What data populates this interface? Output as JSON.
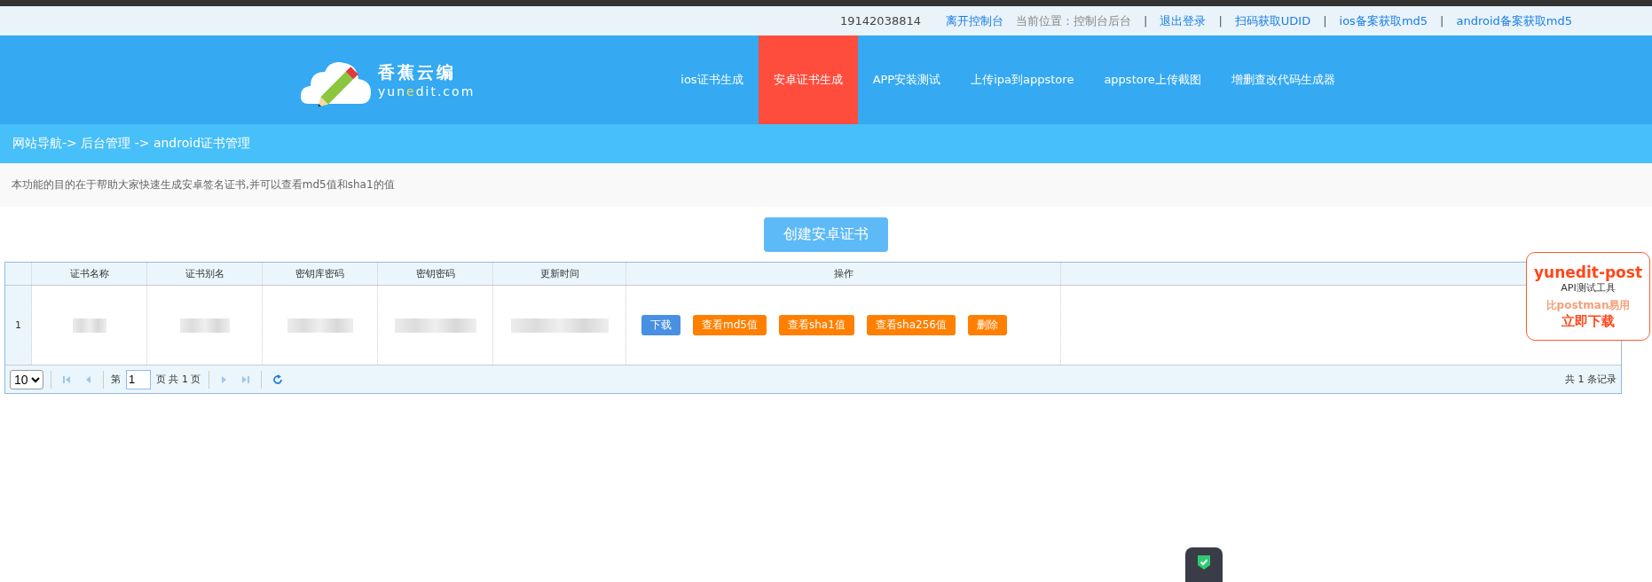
{
  "top_bar": {
    "phone": "19142038814",
    "items": [
      {
        "kind": "link",
        "text": "离开控制台"
      },
      {
        "kind": "text",
        "text": "当前位置：控制台后台"
      },
      {
        "kind": "sep",
        "text": "|"
      },
      {
        "kind": "link",
        "text": "退出登录"
      },
      {
        "kind": "sep",
        "text": "|"
      },
      {
        "kind": "link",
        "text": "扫码获取UDID"
      },
      {
        "kind": "sep",
        "text": "|"
      },
      {
        "kind": "link",
        "text": "ios备案获取md5"
      },
      {
        "kind": "sep",
        "text": "|"
      },
      {
        "kind": "link",
        "text": "android备案获取md5"
      }
    ]
  },
  "logo": {
    "name": "香蕉云编",
    "domain": [
      {
        "text": "yun",
        "accent": false
      },
      {
        "text": "e",
        "accent": true
      },
      {
        "text": "dit.com",
        "accent": false
      }
    ]
  },
  "nav": [
    {
      "label": "ios证书生成",
      "selected": false
    },
    {
      "label": "安卓证书生成",
      "selected": true
    },
    {
      "label": "APP安装测试",
      "selected": false
    },
    {
      "label": "上传ipa到appstore",
      "selected": false
    },
    {
      "label": "appstore上传截图",
      "selected": false
    },
    {
      "label": "增删查改代码生成器",
      "selected": false
    }
  ],
  "breadcrumb": "网站导航-> 后台管理 -> android证书管理",
  "description": "本功能的目的在于帮助大家快速生成安卓签名证书,并可以查看md5值和sha1的值",
  "create_button": "创建安卓证书",
  "table": {
    "columns": [
      "证书名称",
      "证书别名",
      "密钥库密码",
      "密钥密码",
      "更新时间",
      "操作"
    ],
    "rows": [
      {
        "number": "1",
        "cells": [
          {
            "redacted": true
          },
          {
            "redacted": true
          },
          {
            "redacted": true
          },
          {
            "redacted": true
          },
          {
            "redacted": true
          }
        ],
        "actions": [
          {
            "label": "下载",
            "kind": "primary"
          },
          {
            "label": "查看md5值",
            "kind": "warning"
          },
          {
            "label": "查看sha1值",
            "kind": "warning"
          },
          {
            "label": "查看sha256值",
            "kind": "warning"
          },
          {
            "label": "删除",
            "kind": "warning"
          }
        ]
      }
    ],
    "pager": {
      "page_size": "10",
      "page_prefix": "第",
      "page": "1",
      "page_suffix": "页 共 1 页",
      "total": "共 1 条记录"
    }
  },
  "ad": {
    "title": "yunedit-post",
    "subtitle": "API测试工具",
    "tagline": "比postman易用",
    "cta": "立即下载"
  }
}
